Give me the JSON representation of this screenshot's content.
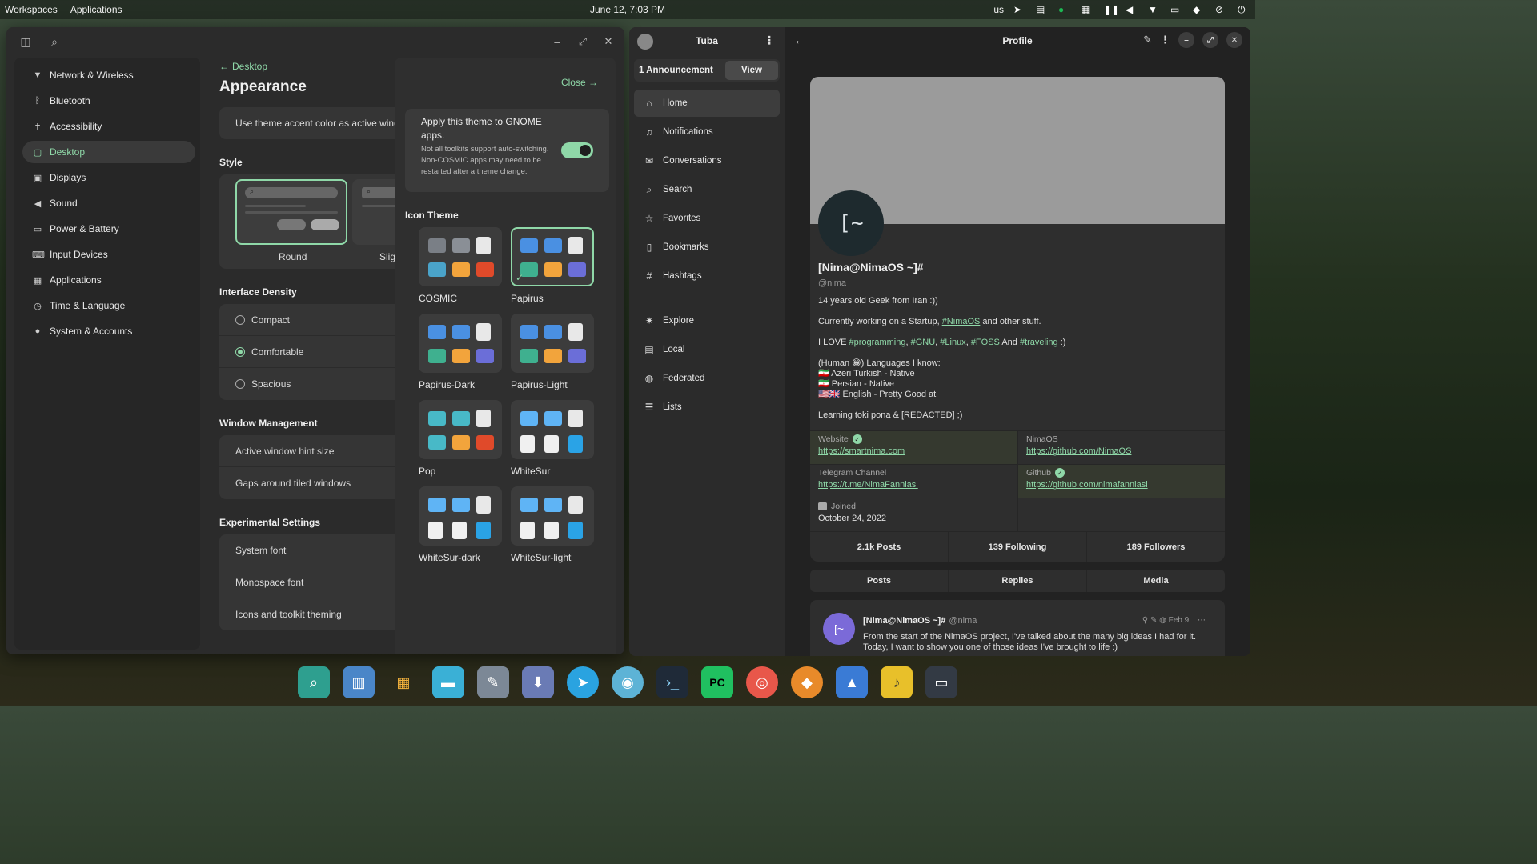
{
  "top_panel": {
    "workspaces": "Workspaces",
    "applications": "Applications",
    "clock": "June 12, 7:03 PM",
    "keyboard_layout": "us",
    "tray_icons": [
      "telegram-icon",
      "app-icon",
      "spotify-icon",
      "window-icon",
      "pause-icon",
      "volume-icon",
      "wifi-icon",
      "battery-icon",
      "notifications-icon",
      "bell-off-icon",
      "power-icon"
    ]
  },
  "settings": {
    "nav": [
      {
        "label": "Network & Wireless",
        "icon": "wifi-icon"
      },
      {
        "label": "Bluetooth",
        "icon": "bluetooth-icon"
      },
      {
        "label": "Accessibility",
        "icon": "accessibility-icon"
      },
      {
        "label": "Desktop",
        "icon": "desktop-icon",
        "active": true
      },
      {
        "label": "Displays",
        "icon": "display-icon"
      },
      {
        "label": "Sound",
        "icon": "sound-icon"
      },
      {
        "label": "Power & Battery",
        "icon": "battery-icon"
      },
      {
        "label": "Input Devices",
        "icon": "keyboard-icon"
      },
      {
        "label": "Applications",
        "icon": "apps-icon"
      },
      {
        "label": "Time & Language",
        "icon": "time-icon"
      },
      {
        "label": "System & Accounts",
        "icon": "user-icon"
      }
    ],
    "back_label": "Desktop",
    "page_title": "Appearance",
    "accent_row": "Use theme accent color as active windo",
    "style_title": "Style",
    "style_options": [
      "Round",
      "Slig"
    ],
    "density_title": "Interface Density",
    "density_options": [
      {
        "label": "Compact",
        "selected": false
      },
      {
        "label": "Comfortable",
        "selected": true
      },
      {
        "label": "Spacious",
        "selected": false
      }
    ],
    "window_mgmt_title": "Window Management",
    "window_mgmt_rows": [
      "Active window hint size",
      "Gaps around tiled windows"
    ],
    "experimental_title": "Experimental Settings",
    "experimental_rows": [
      "System font",
      "Monospace font",
      "Icons and toolkit theming"
    ],
    "panel": {
      "close_label": "Close",
      "apply_title": "Apply this theme to GNOME apps.",
      "apply_desc": "Not all toolkits support auto-switching. Non-COSMIC apps may need to be restarted after a theme change.",
      "apply_enabled": true,
      "icon_theme_title": "Icon Theme",
      "themes": [
        {
          "name": "COSMIC",
          "selected": false
        },
        {
          "name": "Papirus",
          "selected": true
        },
        {
          "name": "Papirus-Dark",
          "selected": false
        },
        {
          "name": "Papirus-Light",
          "selected": false
        },
        {
          "name": "Pop",
          "selected": false
        },
        {
          "name": "WhiteSur",
          "selected": false
        },
        {
          "name": "WhiteSur-dark",
          "selected": false
        },
        {
          "name": "WhiteSur-light",
          "selected": false
        }
      ]
    },
    "accent_color": "#8fd8a8"
  },
  "tuba": {
    "title": "Tuba",
    "announcement": "1 Announcement",
    "view_label": "View",
    "nav": [
      {
        "label": "Home",
        "icon": "home-icon",
        "active": true
      },
      {
        "label": "Notifications",
        "icon": "bell-icon"
      },
      {
        "label": "Conversations",
        "icon": "mail-icon"
      },
      {
        "label": "Search",
        "icon": "search-icon"
      },
      {
        "label": "Favorites",
        "icon": "star-icon"
      },
      {
        "label": "Bookmarks",
        "icon": "bookmark-icon"
      },
      {
        "label": "Hashtags",
        "icon": "hashtag-icon"
      },
      {
        "label": "Explore",
        "icon": "explore-icon"
      },
      {
        "label": "Local",
        "icon": "local-icon"
      },
      {
        "label": "Federated",
        "icon": "globe-icon"
      },
      {
        "label": "Lists",
        "icon": "list-icon"
      }
    ],
    "profile": {
      "header_title": "Profile",
      "avatar_text": "[~",
      "name": "[Nima@NimaOS ~]#",
      "handle": "@nima",
      "bio": {
        "line1": "14 years old Geek from Iran :))",
        "line2_prefix": "Currently working on a Startup, ",
        "line2_link": "#NimaOS",
        "line2_suffix": " and other stuff.",
        "love_prefix": "I LOVE ",
        "love_links": [
          "#programming",
          "#GNU",
          "#Linux",
          "#FOSS"
        ],
        "love_and": " And ",
        "love_last": "#traveling",
        "love_suffix": " :)",
        "lang_intro": "(Human 😁) Languages I know:",
        "langs": [
          "🇮🇷 Azeri Turkish - Native",
          "🇮🇷 Persian - Native",
          "🇺🇸🇬🇧 English - Pretty Good at"
        ],
        "learning": "Learning toki pona & [REDACTED] ;)"
      },
      "fields": [
        {
          "label": "Website",
          "value": "https://smartnima.com",
          "verified": true
        },
        {
          "label": "NimaOS",
          "value": "https://github.com/NimaOS",
          "verified": false
        },
        {
          "label": "Telegram Channel",
          "value": "https://t.me/NimaFanniasl",
          "verified": false
        },
        {
          "label": "Github",
          "value": "https://github.com/nimafanniasl",
          "verified": true
        },
        {
          "label": "Joined",
          "value": "October 24, 2022",
          "verified": false
        },
        {
          "label": "",
          "value": "",
          "verified": false
        }
      ],
      "stats": [
        "2.1k Posts",
        "139 Following",
        "189 Followers"
      ],
      "tabs": [
        "Posts",
        "Replies",
        "Media"
      ],
      "post": {
        "avatar_text": "[~",
        "name": "[Nima@NimaOS ~]#",
        "handle": "@nima",
        "date": "Feb 9",
        "text": "From the start of the NimaOS project, I've talked about the many big ideas I had for it. Today, I want to show you one of those ideas I've brought to life :)"
      }
    }
  },
  "dock": [
    "search-app-icon",
    "files-window-icon",
    "app-grid-icon",
    "folder-icon",
    "text-editor-icon",
    "store-icon",
    "telegram-icon",
    "tweaks-icon",
    "terminal-icon",
    "pycharm-icon",
    "target-icon",
    "game-icon",
    "android-studio-icon",
    "tuba-icon",
    "screen-icon"
  ]
}
